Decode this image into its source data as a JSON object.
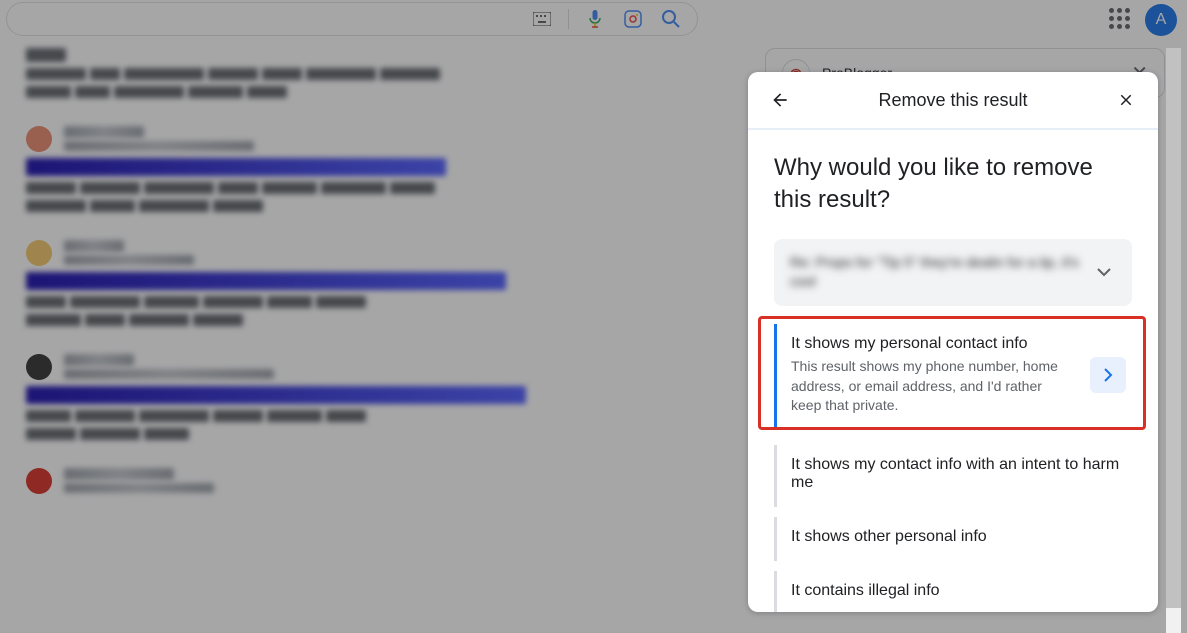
{
  "search": {
    "value": ""
  },
  "avatar": {
    "letter": "A"
  },
  "sidepanel": {
    "source": "ProBlogger"
  },
  "modal": {
    "title": "Remove this result",
    "question": "Why would you like to remove this result?",
    "chip_text": "Re: Props for \"Tip 5\" they're dealin for a tip, it's cool",
    "options": [
      {
        "title": "It shows my personal contact info",
        "desc": "This result shows my phone number, home address, or email address, and I'd rather keep that private.",
        "highlighted": true
      },
      {
        "title": "It shows my contact info with an intent to harm me",
        "desc": "",
        "highlighted": false
      },
      {
        "title": "It shows other personal info",
        "desc": "",
        "highlighted": false
      },
      {
        "title": "It contains illegal info",
        "desc": "",
        "highlighted": false
      }
    ]
  }
}
